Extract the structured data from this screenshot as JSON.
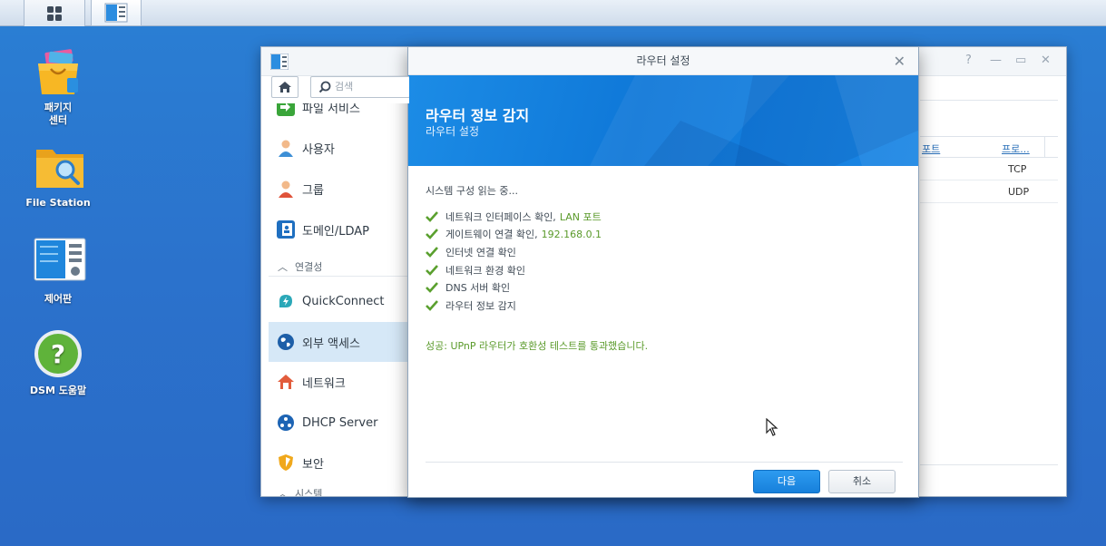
{
  "taskbar": {
    "main_menu_icon": "grid-icon",
    "control_panel_task_icon": "control-panel-icon"
  },
  "desktop": {
    "icons": [
      {
        "label": "패키지\n센터",
        "icon": "package-center-icon"
      },
      {
        "label": "File Station",
        "icon": "file-station-icon"
      },
      {
        "label": "제어판",
        "icon": "control-panel-icon"
      },
      {
        "label": "DSM 도움말",
        "icon": "help-icon"
      }
    ]
  },
  "control_panel": {
    "search_placeholder": "검색",
    "sidebar": {
      "items_top": [
        {
          "label": "파일 서비스",
          "icon": "file-services-icon"
        },
        {
          "label": "사용자",
          "icon": "user-icon"
        },
        {
          "label": "그룹",
          "icon": "group-icon"
        },
        {
          "label": "도메인/LDAP",
          "icon": "domain-icon"
        }
      ],
      "section_label": "연결성",
      "items_conn": [
        {
          "label": "QuickConnect",
          "icon": "quickconnect-icon"
        },
        {
          "label": "외부 액세스",
          "icon": "globe-icon"
        },
        {
          "label": "네트워크",
          "icon": "network-icon"
        },
        {
          "label": "DHCP Server",
          "icon": "dhcp-icon"
        },
        {
          "label": "보안",
          "icon": "shield-icon"
        }
      ],
      "section_bottom": "시스템"
    },
    "table": {
      "headers": [
        "포트",
        "프로..."
      ],
      "rows": [
        [
          "",
          "TCP"
        ],
        [
          "",
          "UDP"
        ]
      ]
    }
  },
  "wizard": {
    "window_title": "라우터 설정",
    "banner_title": "라우터 정보 감지",
    "banner_subtitle": "라우터 설정",
    "status": "시스템 구성 읽는 중...",
    "checks": [
      {
        "text": "네트워크 인터페이스 확인,",
        "highlight": "LAN 포트"
      },
      {
        "text": "게이트웨이 연결 확인,",
        "highlight": "192.168.0.1"
      },
      {
        "text": "인터넷 연결 확인",
        "highlight": ""
      },
      {
        "text": "네트워크 환경 확인",
        "highlight": ""
      },
      {
        "text": "DNS 서버 확인",
        "highlight": ""
      },
      {
        "text": "라우터 정보 감지",
        "highlight": ""
      }
    ],
    "success_message": "성공: UPnP 라우터가 호환성 테스트를 통과했습니다.",
    "next_label": "다음",
    "cancel_label": "취소"
  },
  "colors": {
    "desktop": "#2a78d0",
    "banner": "#1a86e4",
    "success": "#5a9a2a",
    "primary_button": "#1f8ae4"
  }
}
